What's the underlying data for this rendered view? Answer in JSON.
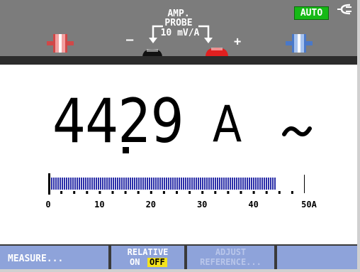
{
  "header": {
    "auto_badge": "AUTO",
    "probe": {
      "line1": "AMP.",
      "line2": "PROBE",
      "line3": "10 mV/A",
      "minus": "–",
      "plus": "+"
    }
  },
  "reading": {
    "digits": "44",
    "decimals": "29",
    "unit": "A",
    "coupling": "AC"
  },
  "bargraph": {
    "value": 44.29,
    "scale_max": 50,
    "labels": [
      "0",
      "10",
      "20",
      "30",
      "40",
      "50A"
    ],
    "bar_color": "#2a2ea8"
  },
  "softkeys": {
    "measure": "MEASURE...",
    "relative_label": "RELATIVE",
    "relative_on": "ON",
    "relative_off": "OFF",
    "adjust_line1": "ADJUST",
    "adjust_line2": "REFERENCE...",
    "f4": ""
  },
  "colors": {
    "auto_green": "#16b916",
    "softkey_blue": "#8ea3da",
    "highlight_yellow": "#f4e31c",
    "red_jack": "#e02020"
  },
  "icons": [
    "power-plug-icon",
    "ac-wave-icon",
    "probe-bracket-icon",
    "black-jack-icon",
    "red-jack-icon",
    "input-a-connector-icon",
    "input-b-connector-icon"
  ]
}
